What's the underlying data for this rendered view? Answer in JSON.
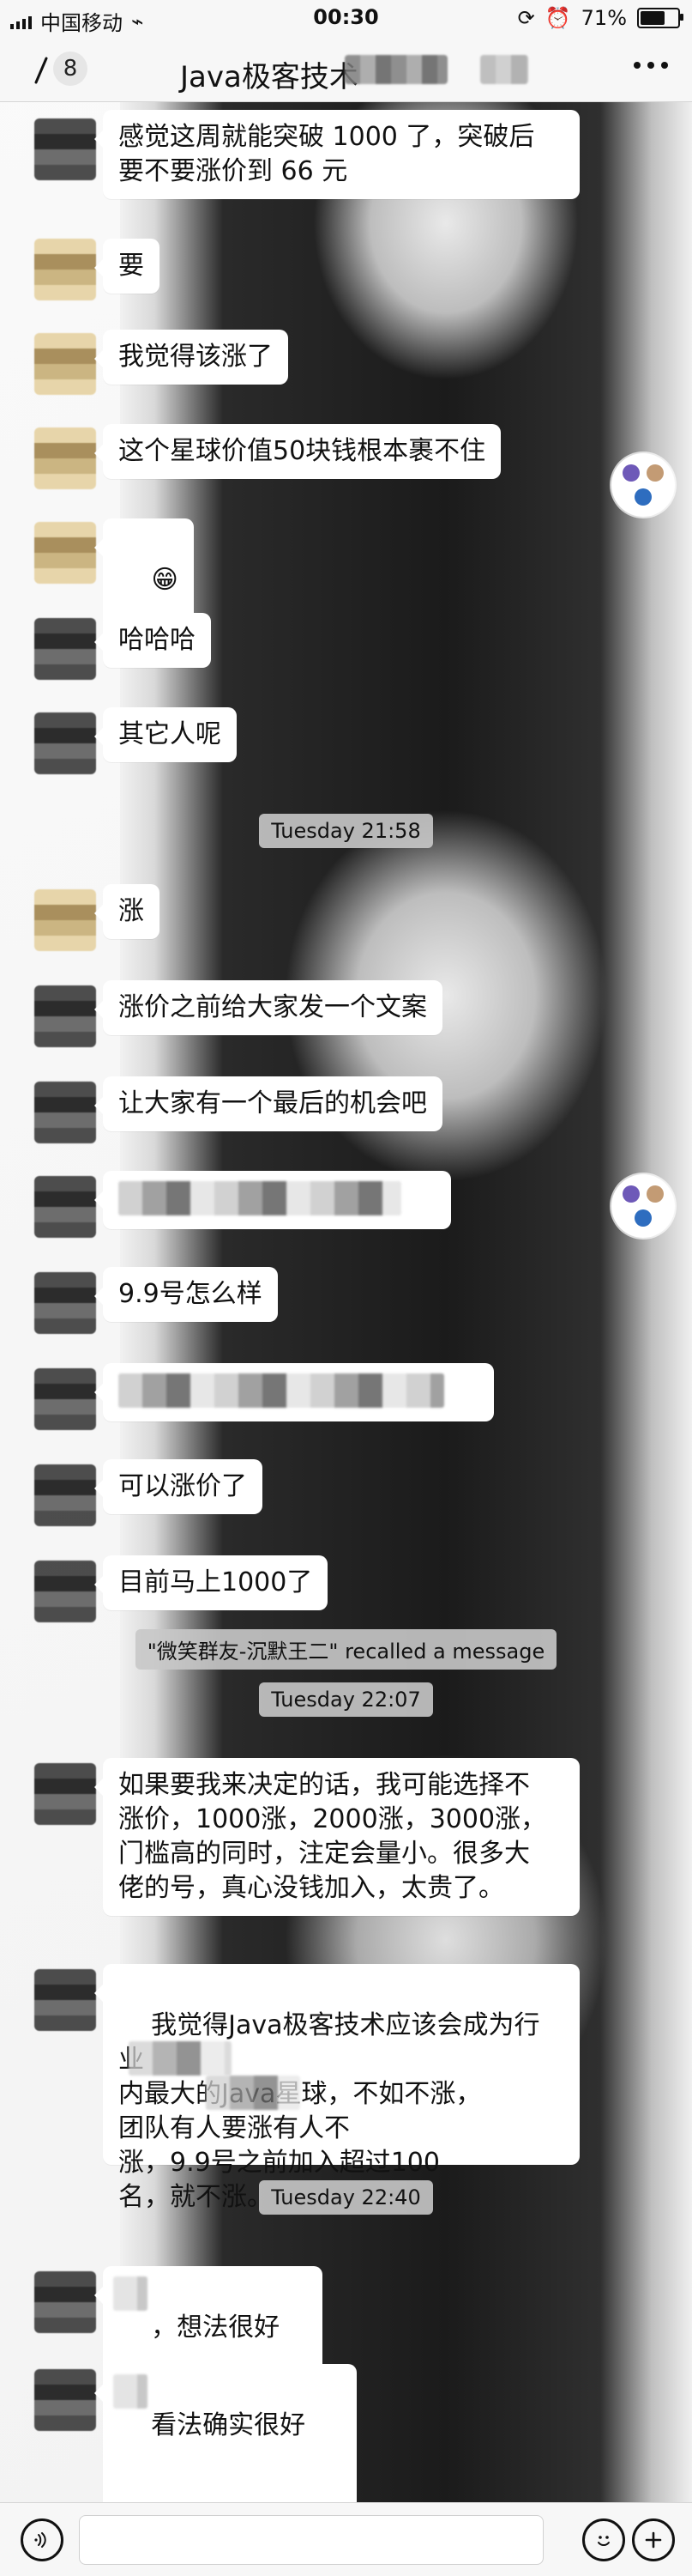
{
  "status_bar": {
    "carrier": "中国移动",
    "time": "00:30",
    "battery": "71%"
  },
  "header": {
    "unread_count": "8",
    "title_visible_part": "Java极客技术",
    "icons": {
      "back": "back-arrow-icon",
      "more": "more-dots-icon"
    }
  },
  "messages": [
    {
      "type": "text",
      "text": "感觉这周就能突破 1000 了，突破后\n要不要涨价到 66 元"
    },
    {
      "type": "text",
      "text": "要"
    },
    {
      "type": "text",
      "text": "我觉得该涨了"
    },
    {
      "type": "text",
      "text": "这个星球价值50块钱根本裹不住"
    },
    {
      "type": "emoji",
      "text": "😁"
    },
    {
      "type": "text",
      "text": "哈哈哈"
    },
    {
      "type": "text",
      "text": "其它人呢"
    },
    {
      "type": "time",
      "text": "Tuesday 21:58"
    },
    {
      "type": "text",
      "text": "涨"
    },
    {
      "type": "text",
      "text": "涨价之前给大家发一个文案"
    },
    {
      "type": "text",
      "text": "让大家有一个最后的机会吧"
    },
    {
      "type": "redacted"
    },
    {
      "type": "text",
      "text": "9.9号怎么样"
    },
    {
      "type": "redacted"
    },
    {
      "type": "text",
      "text": "可以涨价了"
    },
    {
      "type": "text",
      "text": "目前马上1000了"
    },
    {
      "type": "system",
      "text": "\"微笑群友-沉默王二\" recalled a message"
    },
    {
      "type": "time",
      "text": "Tuesday 22:07"
    },
    {
      "type": "text",
      "text": "如果要我来决定的话，我可能选择不\n涨价，1000涨，2000涨，3000涨，\n门槛高的同时，注定会量小。很多大\n佬的号，真心没钱加入，太贵了。"
    },
    {
      "type": "text",
      "text": "我觉得Java极客技术应该会成为行业\n内最大的Java星球，不如不涨，\n团队有人要涨有人不\n涨，9.9号之前加入超过100\n名，就不涨。"
    },
    {
      "type": "time",
      "text": "Tuesday 22:40"
    },
    {
      "type": "text",
      "text": "，想法很好"
    },
    {
      "type": "text",
      "text": "看法确实很好"
    }
  ],
  "input_bar": {
    "icons": [
      "voice-icon",
      "emoji-icon",
      "plus-icon"
    ]
  },
  "colors": {
    "bubble_bg": "#ffffff",
    "bar_bg": "#f7f7f7",
    "time_pill_bg": "#c8c8c8"
  }
}
